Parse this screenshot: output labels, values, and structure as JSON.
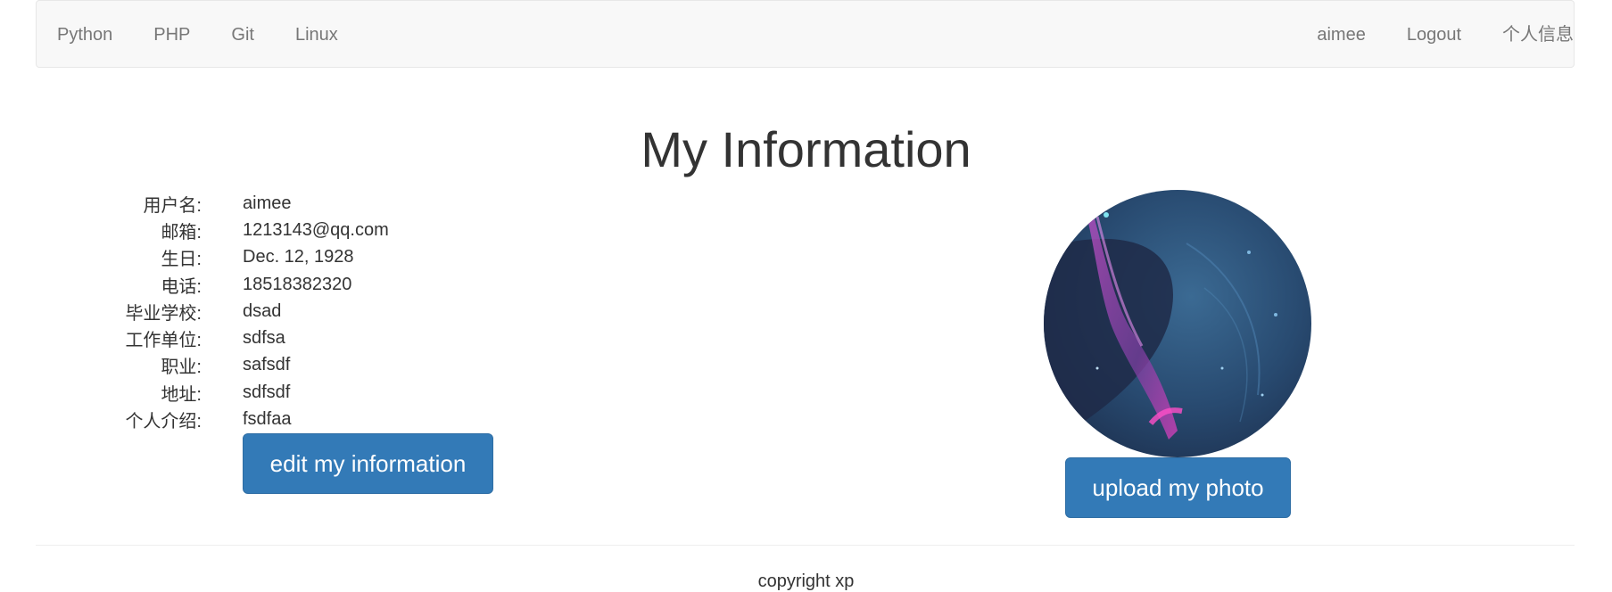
{
  "nav": {
    "left": [
      "Python",
      "PHP",
      "Git",
      "Linux"
    ],
    "right": [
      "aimee",
      "Logout",
      "个人信息"
    ]
  },
  "page_title": "My Information",
  "info": [
    {
      "label": "用户名:",
      "value": "aimee"
    },
    {
      "label": "邮箱:",
      "value": "1213143@qq.com"
    },
    {
      "label": "生日:",
      "value": "Dec. 12, 1928"
    },
    {
      "label": "电话:",
      "value": "18518382320"
    },
    {
      "label": "毕业学校:",
      "value": "dsad"
    },
    {
      "label": "工作单位:",
      "value": "sdfsa"
    },
    {
      "label": "职业:",
      "value": "safsdf"
    },
    {
      "label": "地址:",
      "value": "sdfsdf"
    },
    {
      "label": "个人介绍:",
      "value": "fsdfaa"
    }
  ],
  "buttons": {
    "edit": "edit my information",
    "upload": "upload my photo"
  },
  "footer": "copyright xp",
  "colors": {
    "primary": "#337ab7",
    "navbar_bg": "#f8f8f8",
    "nav_text": "#777777"
  }
}
